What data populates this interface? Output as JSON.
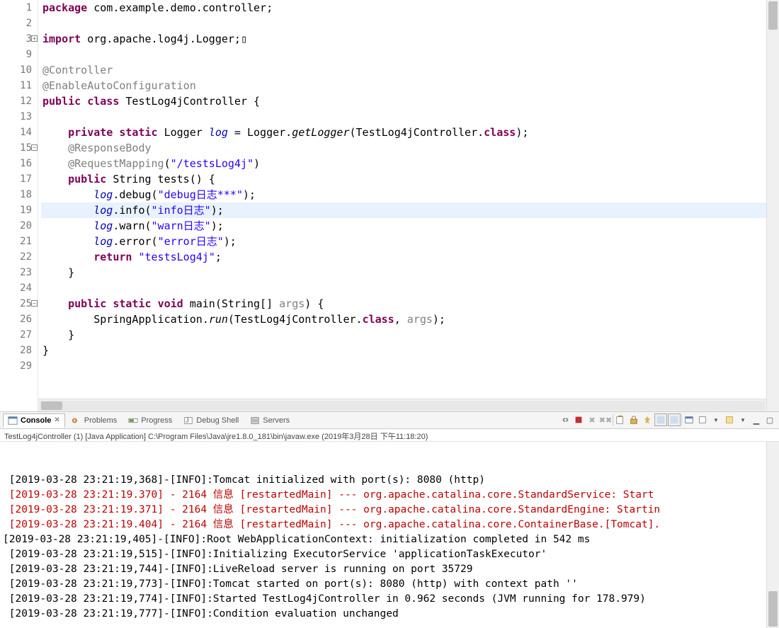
{
  "editor": {
    "lines": [
      {
        "n": "1",
        "html": "<span class='kw'>package</span> com.example.demo.controller;"
      },
      {
        "n": "2",
        "html": ""
      },
      {
        "n": "3",
        "expand": true,
        "html": "<span class='kw'>import</span> org.apache.log4j.Logger;▯"
      },
      {
        "n": "9",
        "html": ""
      },
      {
        "n": "10",
        "html": "<span class='ann'>@Controller</span>"
      },
      {
        "n": "11",
        "html": "<span class='ann'>@EnableAutoConfiguration</span>"
      },
      {
        "n": "12",
        "html": "<span class='kw'>public</span> <span class='kw'>class</span> TestLog4jController {"
      },
      {
        "n": "13",
        "html": ""
      },
      {
        "n": "14",
        "marker": true,
        "html": "    <span class='kw'>private</span> <span class='kw'>static</span> Logger <span class='fld'>log</span> = Logger.<span class='mth'>getLogger</span>(TestLog4jController.<span class='kw'>class</span>);"
      },
      {
        "n": "15",
        "expand": true,
        "marker": true,
        "html": "    <span class='ann'>@ResponseBody</span>"
      },
      {
        "n": "16",
        "marker": true,
        "html": "    <span class='ann'>@RequestMapping</span>(<span class='str'>\"/testsLog4j\"</span>)"
      },
      {
        "n": "17",
        "marker": true,
        "html": "    <span class='kw'>public</span> String tests() {"
      },
      {
        "n": "18",
        "marker": true,
        "html": "        <span class='fld'>log</span>.debug(<span class='str'>\"debug日志***\"</span>);"
      },
      {
        "n": "19",
        "marker": true,
        "hl": true,
        "html": "        <span class='fld'>log</span>.info(<span class='str'>\"info日志\"</span>);"
      },
      {
        "n": "20",
        "marker": true,
        "html": "        <span class='fld'>log</span>.warn(<span class='str'>\"warn日志\"</span>);"
      },
      {
        "n": "21",
        "marker": true,
        "html": "        <span class='fld'>log</span>.error(<span class='str'>\"error日志\"</span>);"
      },
      {
        "n": "22",
        "marker": true,
        "html": "        <span class='kw'>return</span> <span class='str'>\"testsLog4j\"</span>;"
      },
      {
        "n": "23",
        "marker": true,
        "html": "    }"
      },
      {
        "n": "24",
        "html": ""
      },
      {
        "n": "25",
        "expand": true,
        "html": "    <span class='kw'>public</span> <span class='kw'>static</span> <span class='kw'>void</span> main(String[] <span class='com'>args</span>) {"
      },
      {
        "n": "26",
        "html": "        SpringApplication.<span class='mth'>run</span>(TestLog4jController.<span class='kw'>class</span>, <span class='com'>args</span>);"
      },
      {
        "n": "27",
        "html": "    }"
      },
      {
        "n": "28",
        "html": "}"
      },
      {
        "n": "29",
        "html": ""
      }
    ]
  },
  "tabs": {
    "console": "Console",
    "problems": "Problems",
    "progress": "Progress",
    "debug_shell": "Debug Shell",
    "servers": "Servers"
  },
  "launch": "TestLog4jController (1) [Java Application] C:\\Program Files\\Java\\jre1.8.0_181\\bin\\javaw.exe (2019年3月28日 下午11:18:20)",
  "console": [
    {
      "t": " [2019-03-28 23:21:19,368]-[INFO]:Tomcat initialized with port(s): 8080 (http)"
    },
    {
      "t": " [2019-03-28 23:21:19.370] - 2164 信息 [restartedMain] --- org.apache.catalina.core.StandardService: Start",
      "err": true
    },
    {
      "t": " [2019-03-28 23:21:19.371] - 2164 信息 [restartedMain] --- org.apache.catalina.core.StandardEngine: Startin",
      "err": true
    },
    {
      "t": " [2019-03-28 23:21:19.404] - 2164 信息 [restartedMain] --- org.apache.catalina.core.ContainerBase.[Tomcat].",
      "err": true
    },
    {
      "t": "[2019-03-28 23:21:19,405]-[INFO]:Root WebApplicationContext: initialization completed in 542 ms"
    },
    {
      "t": " [2019-03-28 23:21:19,515]-[INFO]:Initializing ExecutorService 'applicationTaskExecutor'"
    },
    {
      "t": " [2019-03-28 23:21:19,744]-[INFO]:LiveReload server is running on port 35729"
    },
    {
      "t": " [2019-03-28 23:21:19,773]-[INFO]:Tomcat started on port(s): 8080 (http) with context path ''"
    },
    {
      "t": " [2019-03-28 23:21:19,774]-[INFO]:Started TestLog4jController in 0.962 seconds (JVM running for 178.979)"
    },
    {
      "t": " [2019-03-28 23:21:19,777]-[INFO]:Condition evaluation unchanged"
    }
  ]
}
